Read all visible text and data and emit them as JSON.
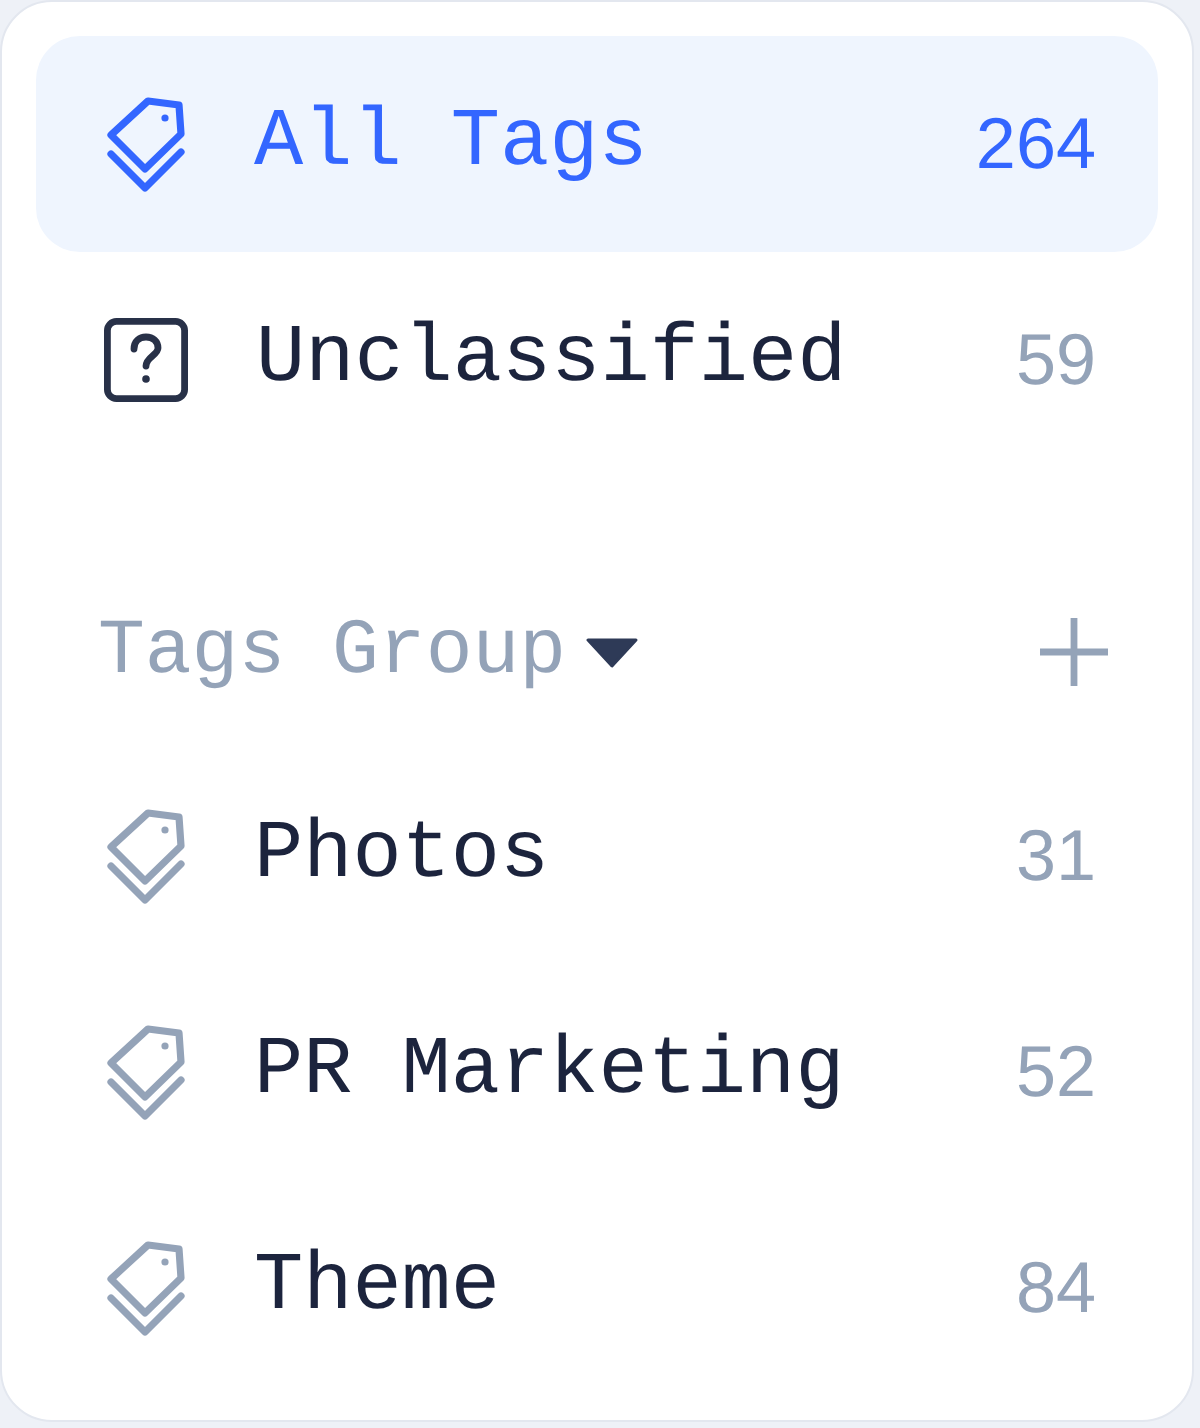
{
  "nav": [
    {
      "kind": "all",
      "label": "All Tags",
      "count": "264",
      "selected": true
    },
    {
      "kind": "unclassified",
      "label": "Unclassified",
      "count": "59",
      "selected": false
    }
  ],
  "group_header": {
    "label": "Tags Group",
    "expanded": true
  },
  "tag_groups": [
    {
      "label": "Photos",
      "count": "31",
      "selected": false
    },
    {
      "label": "PR Marketing",
      "count": "52",
      "selected": false
    },
    {
      "label": "Theme",
      "count": "84",
      "selected": false
    }
  ]
}
